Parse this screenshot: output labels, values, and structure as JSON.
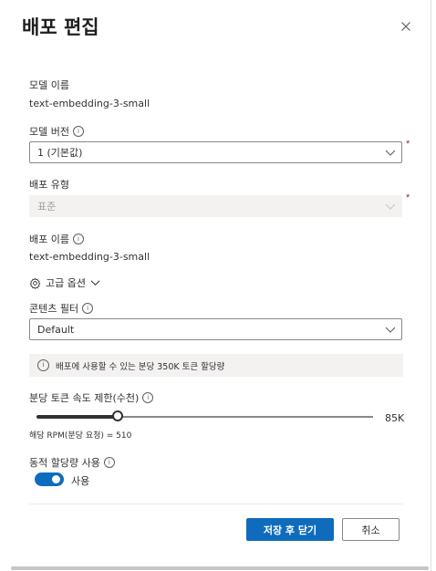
{
  "header": {
    "title": "배포 편집"
  },
  "model_name": {
    "label": "모델 이름",
    "value": "text-embedding-3-small"
  },
  "model_version": {
    "label": "모델 버전",
    "selected": "1 (기본값)",
    "required": "*"
  },
  "deployment_type": {
    "label": "배포 유형",
    "selected": "표준",
    "required": "*"
  },
  "deployment_name": {
    "label": "배포 이름",
    "value": "text-embedding-3-small"
  },
  "advanced": {
    "label": "고급 옵션"
  },
  "content_filter": {
    "label": "콘텐츠 필터",
    "selected": "Default"
  },
  "info_banner": {
    "text": "배포에 사용할 수 있는 분당 350K 토큰 할당량"
  },
  "rate_limit": {
    "label": "분당 토큰 속도 제한(수천)",
    "value_label": "85K",
    "fraction": 0.24,
    "rpm_text": "해당 RPM(분당 요청) = 510"
  },
  "dynamic_quota": {
    "label": "동적 할당량 사용",
    "toggle_label": "사용",
    "enabled": true
  },
  "actions": {
    "save_close": "저장 후 닫기",
    "cancel": "취소"
  },
  "icons": {
    "close": "close-icon",
    "info": "info-icon",
    "chevron": "chevron-down-icon",
    "gear": "gear-icon"
  },
  "colors": {
    "accent": "#0f6cbd",
    "required": "#a4262c"
  }
}
